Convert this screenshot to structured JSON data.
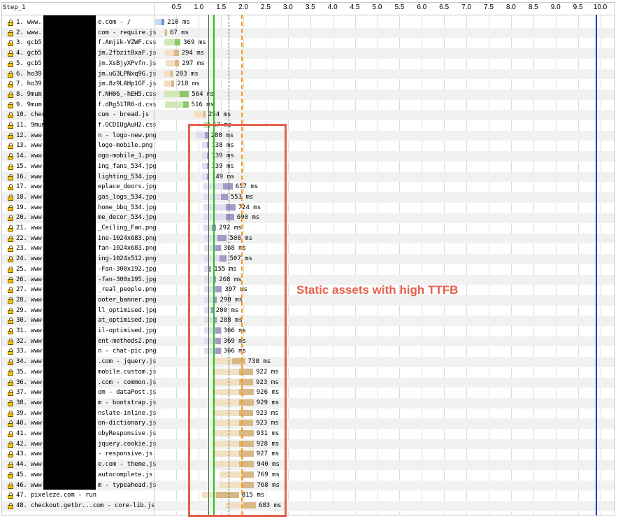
{
  "step_label": "Step_1",
  "axis_ticks": [
    "0.5",
    "1.0",
    "1.5",
    "2.0",
    "2.5",
    "3.0",
    "3.5",
    "4.0",
    "4.5",
    "5.0",
    "5.5",
    "6.0",
    "6.5",
    "7.0",
    "7.5",
    "8.0",
    "8.5",
    "9.0",
    "9.5",
    "10.0"
  ],
  "annotation": "Static assets with high TTFB",
  "colors": {
    "highlight": "#e3604d",
    "start_render": "#28c01e",
    "dom_content_loaded": "#f39c12",
    "onload": "#1c3fbf",
    "first_paint": "#1e7d1e"
  },
  "markers": {
    "start_render_s": 1.33,
    "first_paint_s": 1.21,
    "dom_loaded_s": 1.67,
    "dom_content_loaded_s": 1.95,
    "onload_s": 9.9
  },
  "requests": [
    {
      "label": "1. www.",
      "suffix": "e.com - /",
      "type": "html",
      "start": 0.02,
      "end": 0.23,
      "ttfb": 0.15,
      "duration": "210 ms",
      "secure": true
    },
    {
      "label": "2. www.",
      "suffix": "com - require.js",
      "type": "js",
      "start": 0.22,
      "end": 0.29,
      "ttfb": 0.03,
      "duration": "67 ms",
      "secure": true
    },
    {
      "label": "3. gcb5",
      "suffix": "f.Amjik-VZWF.css",
      "type": "css",
      "start": 0.22,
      "end": 0.59,
      "ttfb": 0.25,
      "duration": "369 ms",
      "secure": true
    },
    {
      "label": "4. gcb5",
      "suffix": "jm.2fbzit8xaF.js",
      "type": "js",
      "start": 0.25,
      "end": 0.55,
      "ttfb": 0.2,
      "duration": "294 ms",
      "secure": true
    },
    {
      "label": "5. gcb5",
      "suffix": "jm.XsBjyXPvfn.js",
      "type": "js",
      "start": 0.26,
      "end": 0.56,
      "ttfb": 0.2,
      "duration": "297 ms",
      "secure": true
    },
    {
      "label": "6. ho39",
      "suffix": "jm.uG3LPNxq9G.js",
      "type": "js",
      "start": 0.22,
      "end": 0.42,
      "ttfb": 0.15,
      "duration": "203 ms",
      "secure": true
    },
    {
      "label": "7. ho39",
      "suffix": "jm.8z9LAHp1GF.js",
      "type": "js",
      "start": 0.23,
      "end": 0.45,
      "ttfb": 0.15,
      "duration": "218 ms",
      "secure": true
    },
    {
      "label": "8. 9mum",
      "suffix": "f.NH06_-hEH5.css",
      "type": "css",
      "start": 0.22,
      "end": 0.78,
      "ttfb": 0.35,
      "duration": "564 ms",
      "secure": true
    },
    {
      "label": "9. 9mum",
      "suffix": "f.dRg51TR6-d.css",
      "type": "css",
      "start": 0.25,
      "end": 0.77,
      "ttfb": 0.4,
      "duration": "516 ms",
      "secure": true
    },
    {
      "label": "10. chec",
      "suffix": "com - bread.js",
      "type": "js",
      "start": 0.9,
      "end": 1.15,
      "ttfb": 0.2,
      "duration": "254 ms",
      "secure": true
    },
    {
      "label": "11. 9mum",
      "suffix": "f.OCDIUgAuH2.css",
      "type": "css",
      "start": 1.1,
      "end": 1.25,
      "ttfb": 0.1,
      "duration": "67 ms",
      "secure": true
    },
    {
      "label": "12. www-",
      "suffix": "n - logo-new.png",
      "type": "img",
      "start": 0.93,
      "end": 1.21,
      "ttfb": 0.2,
      "duration": "280 ms",
      "secure": true
    },
    {
      "label": "13. www-",
      "suffix": "logo-mobile.png",
      "type": "img",
      "start": 1.08,
      "end": 1.22,
      "ttfb": 0.1,
      "duration": "138 ms",
      "secure": true
    },
    {
      "label": "14. www-",
      "suffix": "ogo-mobile_1.png",
      "type": "img",
      "start": 1.08,
      "end": 1.22,
      "ttfb": 0.1,
      "duration": "139 ms",
      "secure": true
    },
    {
      "label": "15. www-",
      "suffix": "ing_fans_534.jpg",
      "type": "img",
      "start": 1.08,
      "end": 1.22,
      "ttfb": 0.1,
      "duration": "139 ms",
      "secure": true
    },
    {
      "label": "16. www-",
      "suffix": "lighting_534.jpg",
      "type": "img",
      "start": 1.08,
      "end": 1.23,
      "ttfb": 0.1,
      "duration": "149 ms",
      "secure": true
    },
    {
      "label": "17. www-",
      "suffix": "eplace_doors.jpg",
      "type": "img",
      "start": 1.1,
      "end": 1.76,
      "ttfb": 0.45,
      "duration": "657 ms",
      "secure": true
    },
    {
      "label": "18. www-",
      "suffix": "gas_logs_534.jpg",
      "type": "img",
      "start": 1.1,
      "end": 1.65,
      "ttfb": 0.4,
      "duration": "553 ms",
      "secure": true
    },
    {
      "label": "19. www-",
      "suffix": "home_bbq_534.jpg",
      "type": "img",
      "start": 1.1,
      "end": 1.82,
      "ttfb": 0.5,
      "duration": "724 ms",
      "secure": true
    },
    {
      "label": "20. www-",
      "suffix": "me_decor_534.jpg",
      "type": "img",
      "start": 1.1,
      "end": 1.79,
      "ttfb": 0.5,
      "duration": "690 ms",
      "secure": true
    },
    {
      "label": "21. www-",
      "suffix": "_Ceiling_Fan.png",
      "type": "img",
      "start": 1.1,
      "end": 1.39,
      "ttfb": 0.2,
      "duration": "292 ms",
      "secure": true
    },
    {
      "label": "22. www-",
      "suffix": "ine-1024x683.png",
      "type": "img",
      "start": 1.12,
      "end": 1.63,
      "ttfb": 0.3,
      "duration": "508 ms",
      "secure": true
    },
    {
      "label": "23. www-",
      "suffix": "fan-1024x683.png",
      "type": "img",
      "start": 1.12,
      "end": 1.49,
      "ttfb": 0.25,
      "duration": "368 ms",
      "secure": true
    },
    {
      "label": "24. www-",
      "suffix": "ing-1024x512.png",
      "type": "img",
      "start": 1.12,
      "end": 1.63,
      "ttfb": 0.35,
      "duration": "507 ms",
      "secure": true
    },
    {
      "label": "25. www-",
      "suffix": "-Fan-300x192.jpg",
      "type": "img",
      "start": 1.12,
      "end": 1.28,
      "ttfb": 0.1,
      "duration": "155 ms",
      "secure": true
    },
    {
      "label": "26. www-",
      "suffix": "-fan-300x195.jpg",
      "type": "img",
      "start": 1.12,
      "end": 1.39,
      "ttfb": 0.2,
      "duration": "268 ms",
      "secure": true
    },
    {
      "label": "27. www-",
      "suffix": "_real_people.png",
      "type": "img",
      "start": 1.12,
      "end": 1.52,
      "ttfb": 0.25,
      "duration": "397 ms",
      "secure": true
    },
    {
      "label": "28. www-",
      "suffix": "ooter_banner.png",
      "type": "img",
      "start": 1.12,
      "end": 1.41,
      "ttfb": 0.2,
      "duration": "290 ms",
      "secure": true
    },
    {
      "label": "29. www-",
      "suffix": "ll_optimised.jpg",
      "type": "img",
      "start": 1.12,
      "end": 1.32,
      "ttfb": 0.15,
      "duration": "200 ms",
      "secure": true
    },
    {
      "label": "30. www-",
      "suffix": "at_optimised.jpg",
      "type": "img",
      "start": 1.12,
      "end": 1.41,
      "ttfb": 0.2,
      "duration": "288 ms",
      "secure": true
    },
    {
      "label": "31. www-",
      "suffix": "il-optimised.jpg",
      "type": "img",
      "start": 1.12,
      "end": 1.49,
      "ttfb": 0.25,
      "duration": "366 ms",
      "secure": true
    },
    {
      "label": "32. www-",
      "suffix": "ent-methods2.png",
      "type": "img",
      "start": 1.12,
      "end": 1.49,
      "ttfb": 0.25,
      "duration": "369 ms",
      "secure": true
    },
    {
      "label": "33. www-",
      "suffix": "n - chat-pic.png",
      "type": "img",
      "start": 1.12,
      "end": 1.49,
      "ttfb": 0.25,
      "duration": "366 ms",
      "secure": true
    },
    {
      "label": "34. www-",
      "suffix": ".com - jquery.js",
      "type": "js",
      "start": 1.3,
      "end": 2.04,
      "ttfb": 0.45,
      "duration": "738 ms",
      "secure": true
    },
    {
      "label": "35. www-",
      "suffix": "mobile.custom.js",
      "type": "js",
      "start": 1.3,
      "end": 2.22,
      "ttfb": 0.6,
      "duration": "922 ms",
      "secure": true
    },
    {
      "label": "36. www-",
      "suffix": ".com - common.js",
      "type": "js",
      "start": 1.3,
      "end": 2.22,
      "ttfb": 0.6,
      "duration": "923 ms",
      "secure": true
    },
    {
      "label": "37. www-",
      "suffix": "om - dataPost.js",
      "type": "js",
      "start": 1.3,
      "end": 2.23,
      "ttfb": 0.6,
      "duration": "926 ms",
      "secure": true
    },
    {
      "label": "38. www-",
      "suffix": "m - bootstrap.js",
      "type": "js",
      "start": 1.3,
      "end": 2.23,
      "ttfb": 0.6,
      "duration": "929 ms",
      "secure": true
    },
    {
      "label": "39. www-",
      "suffix": "nslate-inline.js",
      "type": "js",
      "start": 1.3,
      "end": 2.22,
      "ttfb": 0.6,
      "duration": "923 ms",
      "secure": true
    },
    {
      "label": "40. www-",
      "suffix": "on-dictionary.js",
      "type": "js",
      "start": 1.3,
      "end": 2.22,
      "ttfb": 0.6,
      "duration": "923 ms",
      "secure": true
    },
    {
      "label": "41. www-",
      "suffix": "obyResponsive.js",
      "type": "js",
      "start": 1.3,
      "end": 2.23,
      "ttfb": 0.6,
      "duration": "931 ms",
      "secure": true
    },
    {
      "label": "42. www-",
      "suffix": "jquery.cookie.js",
      "type": "js",
      "start": 1.3,
      "end": 2.23,
      "ttfb": 0.6,
      "duration": "928 ms",
      "secure": true
    },
    {
      "label": "43. www-",
      "suffix": " - responsive.js",
      "type": "js",
      "start": 1.3,
      "end": 2.23,
      "ttfb": 0.6,
      "duration": "927 ms",
      "secure": true
    },
    {
      "label": "44. www-",
      "suffix": "e.com - theme.js",
      "type": "js",
      "start": 1.3,
      "end": 2.24,
      "ttfb": 0.6,
      "duration": "940 ms",
      "secure": true
    },
    {
      "label": "45. www-",
      "suffix": " autocomplete.js",
      "type": "js",
      "start": 1.47,
      "end": 2.24,
      "ttfb": 0.5,
      "duration": "769 ms",
      "secure": true
    },
    {
      "label": "46. www-",
      "suffix": "m - typeahead.js",
      "type": "js",
      "start": 1.47,
      "end": 2.24,
      "ttfb": 0.5,
      "duration": "768 ms",
      "secure": true
    },
    {
      "label": "47. pixeleze.com - run",
      "suffix": "",
      "type": "script",
      "start": 1.08,
      "end": 1.9,
      "ttfb": 0.3,
      "duration": "815 ms",
      "secure": true
    },
    {
      "label": "48. checkout.getbr...com - core-lib.js",
      "suffix": "",
      "type": "js",
      "start": 1.6,
      "end": 2.28,
      "ttfb": 0.4,
      "duration": "683 ms",
      "secure": true
    }
  ]
}
